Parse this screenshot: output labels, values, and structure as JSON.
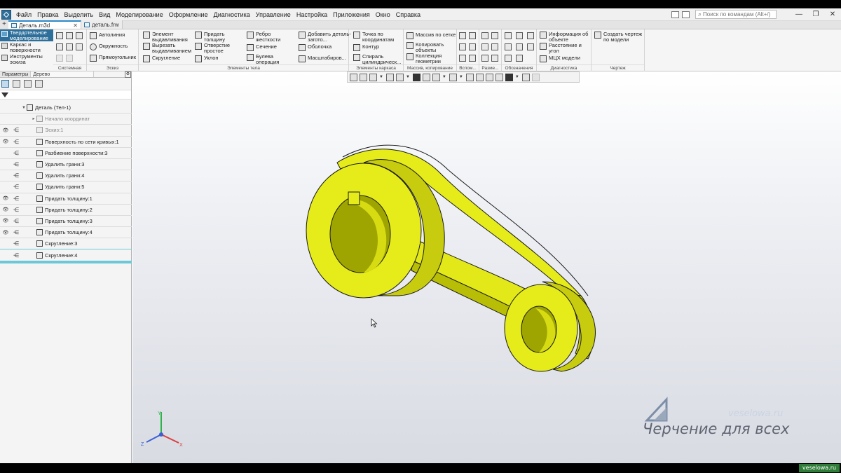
{
  "menu": {
    "items": [
      "Файл",
      "Правка",
      "Выделить",
      "Вид",
      "Моделирование",
      "Оформление",
      "Диагностика",
      "Управление",
      "Настройка",
      "Приложения",
      "Окно",
      "Справка"
    ],
    "search_placeholder": "Поиск по командам (Alt+/)"
  },
  "tabs": [
    {
      "label": "Деталь.m3d",
      "active": true
    },
    {
      "label": "деталь.frw",
      "active": false
    }
  ],
  "ribbon": {
    "modes": [
      "Твердотельное моделирование",
      "Каркас и поверхности",
      "Инструменты эскиза"
    ],
    "groups": {
      "system": "Системная",
      "sketch": "Эскиз",
      "body": "Элементы тела",
      "frame": "Элементы каркаса",
      "array": "Массив, копирование",
      "aux": "Вспом...",
      "dims": "Разме...",
      "notation": "Обозначения",
      "diag": "Диагностика",
      "drawing": "Чертеж"
    },
    "sketch_items": [
      "Автолиния",
      "Окружность",
      "Прямоугольник"
    ],
    "body_items": [
      "Элемент выдавливания",
      "Вырезать выдавливанием",
      "Скругление",
      "Придать толщину",
      "Отверстие простое",
      "Уклон",
      "Ребро жесткости",
      "Сечение",
      "Булева операция",
      "Добавить деталь-загото...",
      "Оболочка",
      "Масштабиров..."
    ],
    "frame_items": [
      "Точка по координатам",
      "Контур",
      "Спираль цилиндрическ..."
    ],
    "array_items": [
      "Массив по сетке",
      "Копировать объекты",
      "Коллекция геометрии"
    ],
    "diag_items": [
      "Информация об объекте",
      "Расстояние и угол",
      "МЦХ модели"
    ],
    "drawing_items": [
      "Создать чертеж по модели"
    ]
  },
  "panel": {
    "tabs": [
      "Параметры",
      "Дерево"
    ]
  },
  "tree": [
    {
      "label": "Деталь (Тел-1)",
      "eye": false,
      "indep": false,
      "dim": false,
      "level": 0
    },
    {
      "label": "Начало координат",
      "eye": false,
      "indep": false,
      "dim": true,
      "level": 1
    },
    {
      "label": "Эскиз:1",
      "eye": true,
      "indep": true,
      "dim": true,
      "level": 1
    },
    {
      "label": "Поверхность по сети кривых:1",
      "eye": true,
      "indep": true,
      "dim": false,
      "level": 1
    },
    {
      "label": "Разбиение поверхности:3",
      "eye": false,
      "indep": true,
      "dim": false,
      "level": 1
    },
    {
      "label": "Удалить грани:3",
      "eye": false,
      "indep": true,
      "dim": false,
      "level": 1
    },
    {
      "label": "Удалить грани:4",
      "eye": false,
      "indep": true,
      "dim": false,
      "level": 1
    },
    {
      "label": "Удалить грани:5",
      "eye": false,
      "indep": true,
      "dim": false,
      "level": 1
    },
    {
      "label": "Придать толщину:1",
      "eye": true,
      "indep": true,
      "dim": false,
      "level": 1
    },
    {
      "label": "Придать толщину:2",
      "eye": true,
      "indep": true,
      "dim": false,
      "level": 1
    },
    {
      "label": "Придать толщину:3",
      "eye": true,
      "indep": true,
      "dim": false,
      "level": 1
    },
    {
      "label": "Придать толщину:4",
      "eye": true,
      "indep": true,
      "dim": false,
      "level": 1
    },
    {
      "label": "Скругление:3",
      "eye": false,
      "indep": true,
      "dim": false,
      "level": 1
    },
    {
      "label": "Скругление:4",
      "eye": false,
      "indep": true,
      "dim": false,
      "level": 1
    }
  ],
  "axes": {
    "x": "X",
    "y": "Y",
    "z": "Z"
  },
  "watermark": {
    "text": "Черчение для всех",
    "site": "veselowa.ru"
  },
  "site_badge": "veselowa.ru",
  "colors": {
    "part_fill": "#e6ec1a",
    "part_dark": "#c7cc0e",
    "part_shadow": "#a4a800",
    "accent": "#2d6f9a",
    "selection": "#6cc8d8"
  }
}
